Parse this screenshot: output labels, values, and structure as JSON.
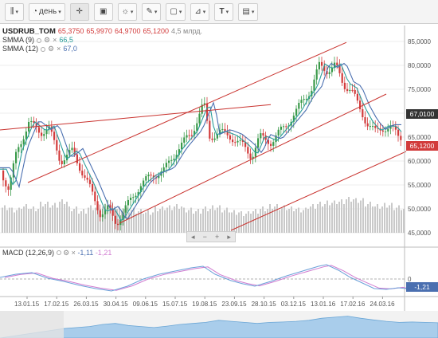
{
  "toolbar": {
    "period_label": "день",
    "icons": [
      "bars-icon",
      "calendar-icon",
      "crosshair-icon",
      "chart-type-icon",
      "indicators-icon",
      "pen-icon",
      "shapes-icon",
      "fib-icon",
      "text-icon",
      "image-icon"
    ]
  },
  "legend": {
    "symbol": "USDRUB_TOM",
    "open": "65,3750",
    "high": "65,9970",
    "low": "64,9700",
    "close": "65,1200",
    "volume": "4,5 млрд.",
    "smma1_label": "SMMA (9)",
    "smma1_value": "66,5",
    "smma2_label": "SMMA (12)",
    "smma2_value": "67,0",
    "macd_label": "MACD (12,26,9)",
    "macd_v1": "-1,11",
    "macd_v2": "-1,21"
  },
  "price_tags": {
    "smma": "67,0100",
    "last": "65,1200",
    "macd": "-1,21"
  },
  "colors": {
    "up": "#3a9a4a",
    "down": "#d23b3b",
    "smma9": "#2a9d9a",
    "smma12": "#4a6fb0",
    "trend": "#c9332f",
    "volume": "#c9c9c9",
    "macd": "#6a9fd8",
    "signal": "#d07bd0",
    "navigator": "#a9cdeb"
  },
  "chart_data": {
    "type": "candlestick",
    "y_ticks": [
      "85,0000",
      "80,0000",
      "75,0000",
      "70,0000",
      "65,0000",
      "60,0000",
      "55,0000",
      "50,0000",
      "45,0000"
    ],
    "x_ticks": [
      "13.01.15",
      "17.02.15",
      "26.03.15",
      "30.04.15",
      "09.06.15",
      "15.07.15",
      "19.08.15",
      "23.09.15",
      "28.10.15",
      "03.12.15",
      "13.01.16",
      "17.02.16",
      "24.03.16"
    ],
    "ylim": [
      45,
      87
    ],
    "price_path": [
      [
        0,
        58
      ],
      [
        10,
        54
      ],
      [
        20,
        62
      ],
      [
        35,
        68
      ],
      [
        50,
        66
      ],
      [
        60,
        67
      ],
      [
        75,
        60
      ],
      [
        90,
        62
      ],
      [
        110,
        55
      ],
      [
        125,
        49
      ],
      [
        135,
        50
      ],
      [
        145,
        47
      ],
      [
        160,
        51
      ],
      [
        175,
        55
      ],
      [
        190,
        57
      ],
      [
        205,
        58
      ],
      [
        220,
        62
      ],
      [
        240,
        66
      ],
      [
        255,
        72
      ],
      [
        262,
        65
      ],
      [
        275,
        66
      ],
      [
        290,
        65
      ],
      [
        305,
        63
      ],
      [
        315,
        61
      ],
      [
        325,
        65
      ],
      [
        340,
        64
      ],
      [
        350,
        66
      ],
      [
        360,
        68
      ],
      [
        370,
        70
      ],
      [
        380,
        73
      ],
      [
        390,
        75
      ],
      [
        400,
        80
      ],
      [
        410,
        79
      ],
      [
        420,
        80
      ],
      [
        430,
        76
      ],
      [
        440,
        75
      ],
      [
        450,
        71
      ],
      [
        460,
        68
      ],
      [
        470,
        66
      ],
      [
        480,
        67
      ],
      [
        490,
        67
      ],
      [
        500,
        65
      ],
      [
        510,
        65
      ]
    ],
    "volume_levels": [
      0.55,
      0.45,
      0.6,
      0.5,
      0.7,
      0.65,
      0.8,
      0.5,
      0.4,
      0.55,
      0.6,
      0.7,
      0.5,
      0.45,
      0.4,
      0.35,
      0.5,
      0.55,
      0.6,
      0.45,
      0.4,
      0.5,
      0.55,
      0.45,
      0.35,
      0.3,
      0.4,
      0.5,
      0.6,
      0.55,
      0.5,
      0.45,
      0.6,
      0.7,
      0.75,
      0.8,
      0.9,
      0.85,
      0.7,
      0.6,
      0.65,
      0.55,
      0.5
    ],
    "macd_path": [
      [
        0,
        0.2
      ],
      [
        20,
        0.6
      ],
      [
        40,
        0.8
      ],
      [
        60,
        0.1
      ],
      [
        80,
        -0.3
      ],
      [
        100,
        -0.8
      ],
      [
        120,
        -1.2
      ],
      [
        140,
        -1.5
      ],
      [
        160,
        -0.9
      ],
      [
        180,
        0
      ],
      [
        200,
        0.6
      ],
      [
        220,
        1.0
      ],
      [
        240,
        1.4
      ],
      [
        255,
        1.6
      ],
      [
        270,
        0.6
      ],
      [
        290,
        -0.2
      ],
      [
        305,
        -0.6
      ],
      [
        320,
        -0.9
      ],
      [
        340,
        -0.3
      ],
      [
        360,
        0.4
      ],
      [
        380,
        1.0
      ],
      [
        400,
        1.6
      ],
      [
        410,
        1.8
      ],
      [
        425,
        1.1
      ],
      [
        440,
        0.2
      ],
      [
        455,
        -0.5
      ],
      [
        470,
        -1.2
      ],
      [
        485,
        -1.3
      ],
      [
        500,
        -1.1
      ],
      [
        510,
        -1.2
      ]
    ],
    "navigator_levels": [
      0.3,
      0.35,
      0.4,
      0.5,
      0.55,
      0.45,
      0.4,
      0.35,
      0.42,
      0.5,
      0.55,
      0.6,
      0.7,
      0.65,
      0.6,
      0.55,
      0.6,
      0.62,
      0.65,
      0.7,
      0.8,
      0.85,
      0.9,
      0.8,
      0.72,
      0.65,
      0.6,
      0.62,
      0.6,
      0.58
    ]
  }
}
